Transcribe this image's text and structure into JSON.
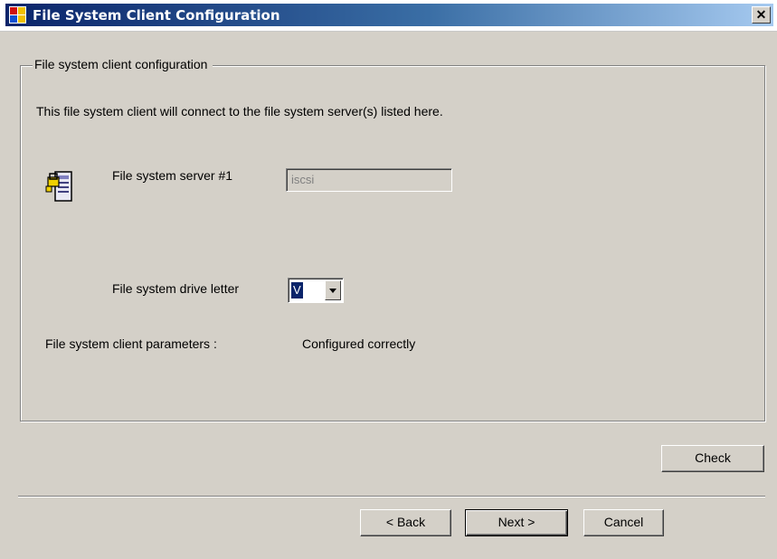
{
  "window": {
    "title": "File System Client Configuration",
    "close_label": "✕",
    "icon": "app-window-icon"
  },
  "group": {
    "label": "File system client configuration",
    "description": "This file system client will connect to the file system server(s) listed here."
  },
  "server": {
    "icon": "server-icon",
    "label": "File system server #1",
    "value": "iscsi"
  },
  "drive": {
    "label": "File system drive letter",
    "selected": "V"
  },
  "parameters": {
    "label": "File system client parameters :",
    "status": "Configured correctly"
  },
  "buttons": {
    "check": "Check",
    "back": "< Back",
    "next": "Next >",
    "cancel": "Cancel"
  },
  "colors": {
    "title_start": "#0a246a",
    "title_end": "#a6caf0",
    "dialog_bg": "#d4d0c8"
  }
}
